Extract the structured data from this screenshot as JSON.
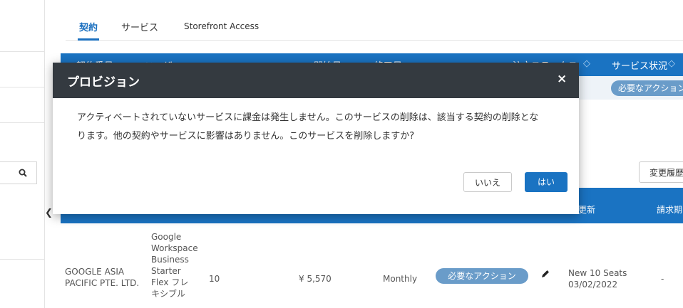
{
  "tabs": [
    {
      "label": "契約",
      "active": true
    },
    {
      "label": "サービス",
      "active": false
    },
    {
      "label": "Storefront Access",
      "active": false
    }
  ],
  "table_header": {
    "col1": "契約番号",
    "col2": "ユーザー",
    "col3": "開始日",
    "col4": "終了日",
    "col5": "注文ステータス",
    "col6": "サービス状況",
    "sort_glyph": "◇"
  },
  "status_band": {
    "pill": "必要なアクション"
  },
  "history_button": "変更履歴",
  "second_header": {
    "renewal": "更新",
    "billing": "請求期"
  },
  "row": {
    "company": [
      "GOOGLE ASIA",
      "PACIFIC PTE. LTD."
    ],
    "product": [
      "Google",
      "Workspace",
      "Business",
      "Starter",
      "Flex フレ",
      "キシブル"
    ],
    "seats": "10",
    "price": "¥ 5,570",
    "cycle": "Monthly",
    "status": "必要なアクション",
    "renewal": [
      "New 10 Seats",
      "03/02/2022"
    ],
    "billing": "-"
  },
  "modal": {
    "title": "プロビジョン",
    "close": "×",
    "body_line1": "アクティベートされていないサービスに課金は発生しません。このサービスの削除は、該当する契約の削除とな",
    "body_line2": "ります。他の契約やサービスに影響はありません。このサービスを削除しますか?",
    "no_button": "いいえ",
    "yes_button": "はい"
  },
  "colors": {
    "accent": "#1a73c2",
    "modal_header": "#343a40",
    "pill": "#6a9cc9"
  },
  "icons": [
    "search-icon",
    "chevron-left-icon",
    "pencil-icon",
    "close-icon",
    "sort-icon"
  ]
}
